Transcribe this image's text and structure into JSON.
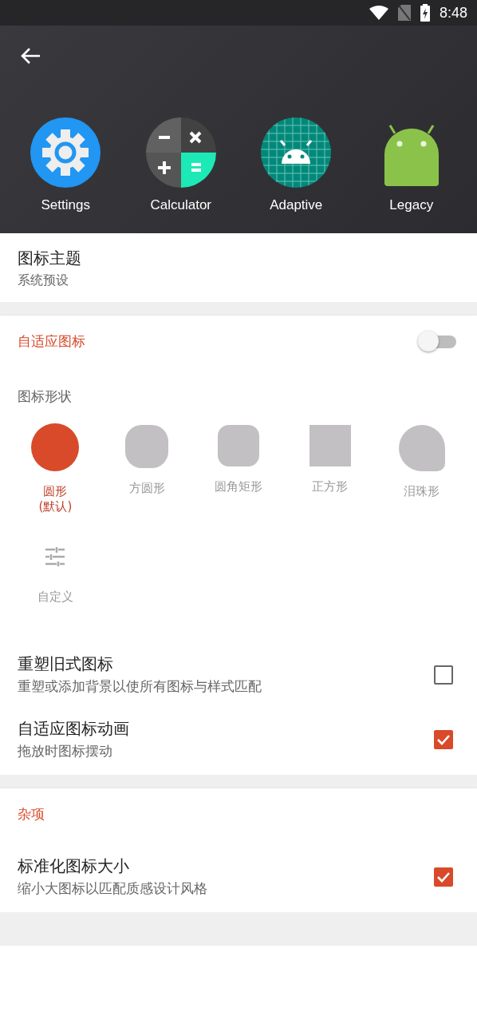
{
  "status_bar": {
    "time": "8:48"
  },
  "preview_icons": [
    {
      "kind": "settings",
      "label": "Settings"
    },
    {
      "kind": "calculator",
      "label": "Calculator"
    },
    {
      "kind": "adaptive",
      "label": "Adaptive"
    },
    {
      "kind": "legacy",
      "label": "Legacy"
    }
  ],
  "icon_theme": {
    "title": "图标主题",
    "value": "系统预设"
  },
  "adaptive_section": {
    "title": "自适应图标",
    "switch_on": false,
    "shape_heading": "图标形状",
    "shapes": [
      {
        "kind": "circle",
        "label": "圆形\n(默认)",
        "selected": true
      },
      {
        "kind": "squircle",
        "label": "方圆形",
        "selected": false
      },
      {
        "kind": "rounded",
        "label": "圆角矩形",
        "selected": false
      },
      {
        "kind": "square",
        "label": "正方形",
        "selected": false
      },
      {
        "kind": "teardrop",
        "label": "泪珠形",
        "selected": false
      },
      {
        "kind": "custom",
        "label": "自定义",
        "selected": false
      }
    ],
    "options": [
      {
        "title": "重塑旧式图标",
        "subtitle": "重塑或添加背景以使所有图标与样式匹配",
        "checked": false
      },
      {
        "title": "自适应图标动画",
        "subtitle": "拖放时图标摆动",
        "checked": true
      }
    ]
  },
  "misc_section": {
    "title": "杂项",
    "options": [
      {
        "title": "标准化图标大小",
        "subtitle": "缩小大图标以匹配质感设计风格",
        "checked": true
      }
    ]
  }
}
